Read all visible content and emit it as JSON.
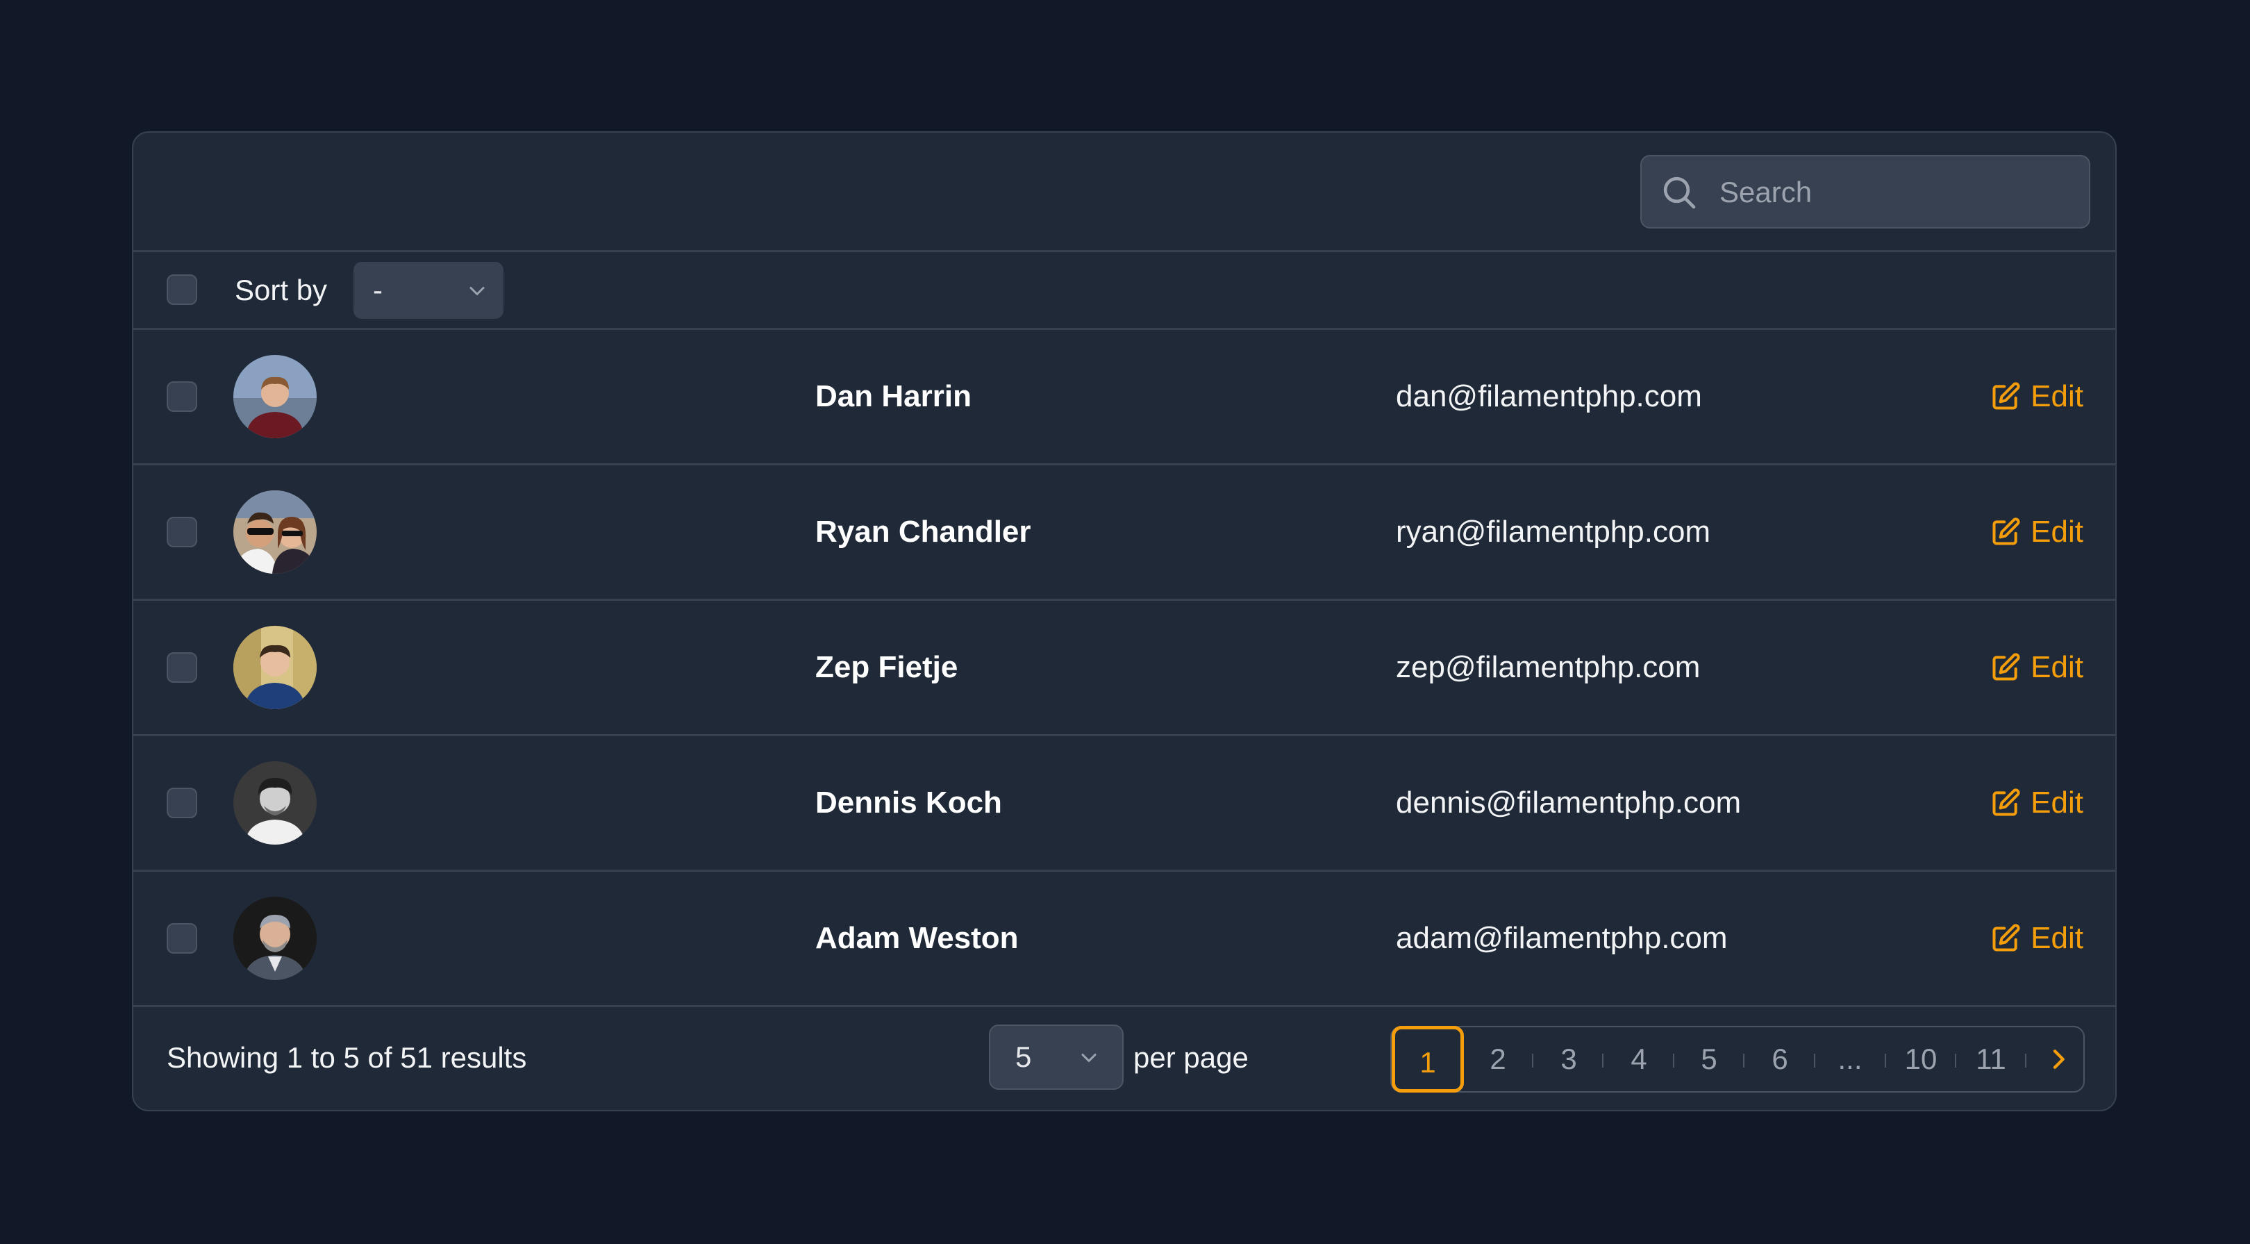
{
  "search": {
    "placeholder": "Search"
  },
  "sort": {
    "label": "Sort by",
    "value": "-"
  },
  "rows": [
    {
      "name": "Dan Harrin",
      "email": "dan@filamentphp.com",
      "action": "Edit"
    },
    {
      "name": "Ryan Chandler",
      "email": "ryan@filamentphp.com",
      "action": "Edit"
    },
    {
      "name": "Zep Fietje",
      "email": "zep@filamentphp.com",
      "action": "Edit"
    },
    {
      "name": "Dennis Koch",
      "email": "dennis@filamentphp.com",
      "action": "Edit"
    },
    {
      "name": "Adam Weston",
      "email": "adam@filamentphp.com",
      "action": "Edit"
    }
  ],
  "footer": {
    "summary": "Showing 1 to 5 of 51 results",
    "per_page_value": "5",
    "per_page_label": "per page"
  },
  "pagination": {
    "pages": [
      "1",
      "2",
      "3",
      "4",
      "5",
      "6",
      "...",
      "10",
      "11"
    ],
    "current": "1"
  },
  "colors": {
    "accent": "#f59e0b",
    "background": "#111827",
    "panel": "#1f2937",
    "border": "#374151"
  },
  "icons": {
    "search": "search-icon",
    "sort_chevron": "chevron-down-icon",
    "edit": "pencil-square-icon",
    "next": "chevron-right-icon"
  }
}
